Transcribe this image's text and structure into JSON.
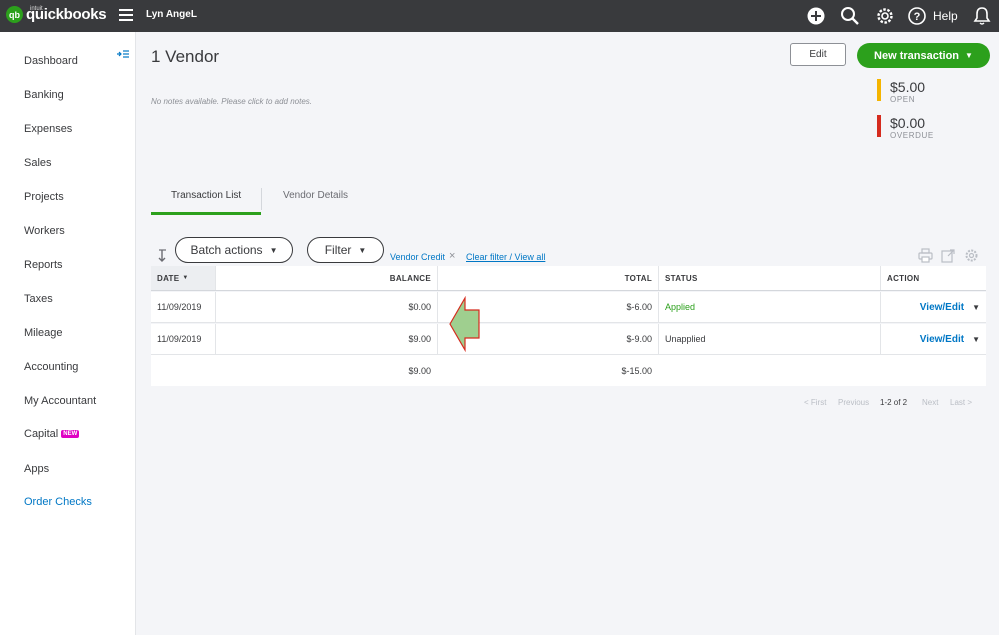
{
  "topbar": {
    "logo_badge": "qb",
    "logo_intuit": "intuit",
    "logo_text": "quickbooks",
    "company_name": "Lyn AngeL",
    "help_label": "Help",
    "icons": [
      "plus-circle-icon",
      "search-icon",
      "gear-icon",
      "help-icon",
      "bell-icon"
    ]
  },
  "sidebar": {
    "items": [
      {
        "label": "Dashboard"
      },
      {
        "label": "Banking"
      },
      {
        "label": "Expenses"
      },
      {
        "label": "Sales"
      },
      {
        "label": "Projects"
      },
      {
        "label": "Workers"
      },
      {
        "label": "Reports"
      },
      {
        "label": "Taxes"
      },
      {
        "label": "Mileage"
      },
      {
        "label": "Accounting"
      },
      {
        "label": "My Accountant"
      },
      {
        "label": "Capital",
        "badge": "NEW"
      },
      {
        "label": "Apps"
      },
      {
        "label": "Order Checks"
      }
    ]
  },
  "header": {
    "title": "1 Vendor",
    "notes_placeholder": "No notes available. Please click to add notes.",
    "edit_label": "Edit",
    "new_transaction_label": "New transaction",
    "open_amount": "$5.00",
    "open_label": "OPEN",
    "overdue_amount": "$0.00",
    "overdue_label": "OVERDUE",
    "colors": {
      "open": "#f4b400",
      "overdue": "#d52b1e",
      "accent": "#2ca01c",
      "link": "#0077c5"
    }
  },
  "tabs": [
    {
      "label": "Transaction List",
      "active": true
    },
    {
      "label": "Vendor Details",
      "active": false
    }
  ],
  "toolbar": {
    "batch_actions_label": "Batch actions",
    "filter_label": "Filter",
    "filter_tag": "Vendor Credit",
    "filter_tag_remove": "×",
    "clear_filter_label": "Clear filter / View all"
  },
  "table": {
    "headers": {
      "date": "DATE",
      "balance": "BALANCE",
      "total": "TOTAL",
      "status": "STATUS",
      "action": "ACTION"
    },
    "rows": [
      {
        "date": "11/09/2019",
        "balance": "$0.00",
        "total": "$-6.00",
        "status": "Applied",
        "action": "View/Edit"
      },
      {
        "date": "11/09/2019",
        "balance": "$9.00",
        "total": "$-9.00",
        "status": "Unapplied",
        "action": "View/Edit"
      }
    ],
    "totals": {
      "balance": "$9.00",
      "total": "$-15.00"
    }
  },
  "pagination": {
    "first": "< First",
    "previous": "Previous",
    "range": "1-2 of 2",
    "next": "Next",
    "last": "Last >"
  }
}
